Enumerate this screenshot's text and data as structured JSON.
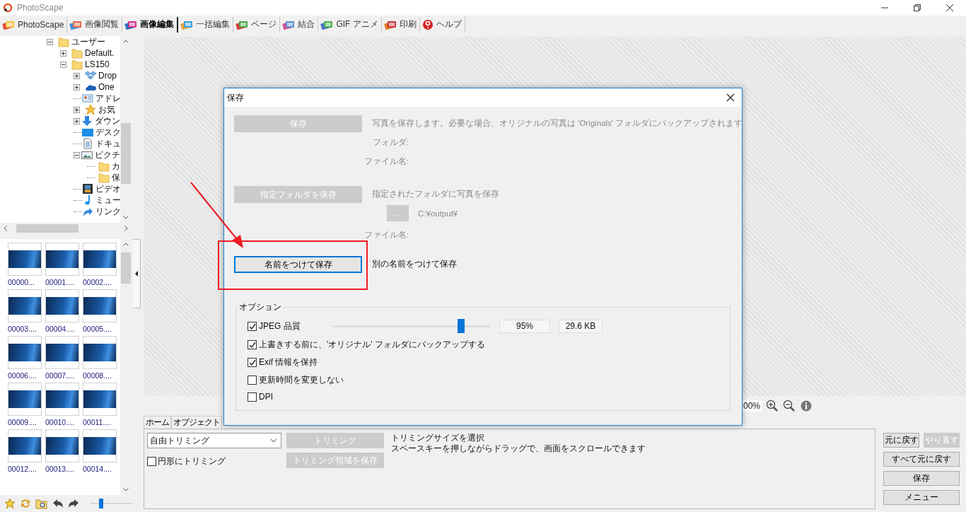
{
  "window": {
    "title": "PhotoScape"
  },
  "tabs": [
    {
      "label": "PhotoScape",
      "selected": false,
      "kind": "home"
    },
    {
      "label": "画像閲覧",
      "selected": false,
      "kind": "viewer"
    },
    {
      "label": "画像編集",
      "selected": true,
      "kind": "editor"
    },
    {
      "label": "一括編集",
      "selected": false,
      "kind": "batch"
    },
    {
      "label": "ページ",
      "selected": false,
      "kind": "page"
    },
    {
      "label": "結合",
      "selected": false,
      "kind": "combine"
    },
    {
      "label": "GIF アニメ",
      "selected": false,
      "kind": "gif"
    },
    {
      "label": "印刷",
      "selected": false,
      "kind": "print"
    },
    {
      "label": "ヘルプ",
      "selected": false,
      "kind": "help"
    }
  ],
  "tree": [
    {
      "label": "ユーザー",
      "kind": "folder",
      "expanded": true,
      "children": [
        {
          "label": "Default.",
          "kind": "folder",
          "expanded": false
        },
        {
          "label": "LS150",
          "kind": "folder",
          "expanded": true,
          "children": [
            {
              "label": "Drop",
              "kind": "box",
              "expanded": false
            },
            {
              "label": "One",
              "kind": "cloud",
              "expanded": false
            },
            {
              "label": "アドレ",
              "kind": "contact"
            },
            {
              "label": "お気",
              "kind": "star",
              "expanded": false
            },
            {
              "label": "ダウン",
              "kind": "download",
              "expanded": false
            },
            {
              "label": "デスク",
              "kind": "desktop"
            },
            {
              "label": "ドキュ",
              "kind": "document"
            },
            {
              "label": "ピクチ",
              "kind": "picture",
              "expanded": true,
              "children": [
                {
                  "label": "カ",
                  "kind": "folder"
                },
                {
                  "label": "保",
                  "kind": "folder"
                }
              ]
            },
            {
              "label": "ビデオ",
              "kind": "video"
            },
            {
              "label": "ミュー",
              "kind": "music"
            },
            {
              "label": "リンク",
              "kind": "link"
            }
          ]
        }
      ]
    }
  ],
  "thumbnails": [
    {
      "label": "00000..."
    },
    {
      "label": "00001...."
    },
    {
      "label": "00002...."
    },
    {
      "label": "00003...."
    },
    {
      "label": "00004...."
    },
    {
      "label": "00005...."
    },
    {
      "label": "00006...."
    },
    {
      "label": "00007...."
    },
    {
      "label": "00008...."
    },
    {
      "label": "00009...."
    },
    {
      "label": "00010...."
    },
    {
      "label": "00011...."
    },
    {
      "label": "00012...."
    },
    {
      "label": "00013...."
    },
    {
      "label": "00014...."
    }
  ],
  "thumbnail_size": {
    "level": 0.2
  },
  "zoom": {
    "value": "00%"
  },
  "edit_tabs": [
    {
      "label": "ホーム",
      "selected": false
    },
    {
      "label": "オブジェクト",
      "selected": false
    }
  ],
  "crop_panel": {
    "mode": "自由トリミング",
    "crop_button": {
      "label": "トリミング",
      "disabled": true
    },
    "save_area_button": {
      "label": "トリミング領域を保存",
      "disabled": true
    },
    "circle": {
      "label": "円形にトリミング",
      "checked": false
    },
    "hint": [
      "トリミングサイズを選択",
      "スペースキーを押しながらドラッグで、画面をスクロールできます"
    ]
  },
  "side_buttons": [
    {
      "label": "元に戻す",
      "disabled": false
    },
    {
      "label": "やり直す",
      "disabled": true
    },
    {
      "label": "すべて元に戻す",
      "disabled": false
    },
    {
      "label": "保存",
      "disabled": false
    },
    {
      "label": "メニュー",
      "disabled": false
    }
  ],
  "dialog": {
    "title": "保存",
    "save": {
      "label": "保存",
      "disabled": true,
      "description": "写真を保存します。必要な場合、オリジナルの写真は 'Originals' フォルダにバックアップされます",
      "folder_label": "フォルダ:",
      "file_label": "ファイル名:"
    },
    "save_to_folder": {
      "label": "指定フォルダを保存",
      "disabled": true,
      "description": "指定されたフォルダに写真を保存",
      "browse": "...",
      "path": "C:¥output¥",
      "file_label": "ファイル名:"
    },
    "save_as": {
      "label": "名前をつけて保存",
      "disabled": false,
      "description": "別の名前をつけて保存"
    },
    "options": {
      "title": "オプション",
      "jpeg_quality": {
        "label": "JPEG 品質",
        "checked": true,
        "level": 0.82,
        "percent": "95%",
        "size": "29.6 KB"
      },
      "checkboxes": [
        {
          "label": "上書きする前に、'オリジナル' フォルダにバックアップする",
          "checked": true
        },
        {
          "label": "Exif 情報を保持",
          "checked": true
        },
        {
          "label": "更新時間を変更しない",
          "checked": false
        },
        {
          "label": "DPI",
          "checked": false
        }
      ]
    }
  }
}
